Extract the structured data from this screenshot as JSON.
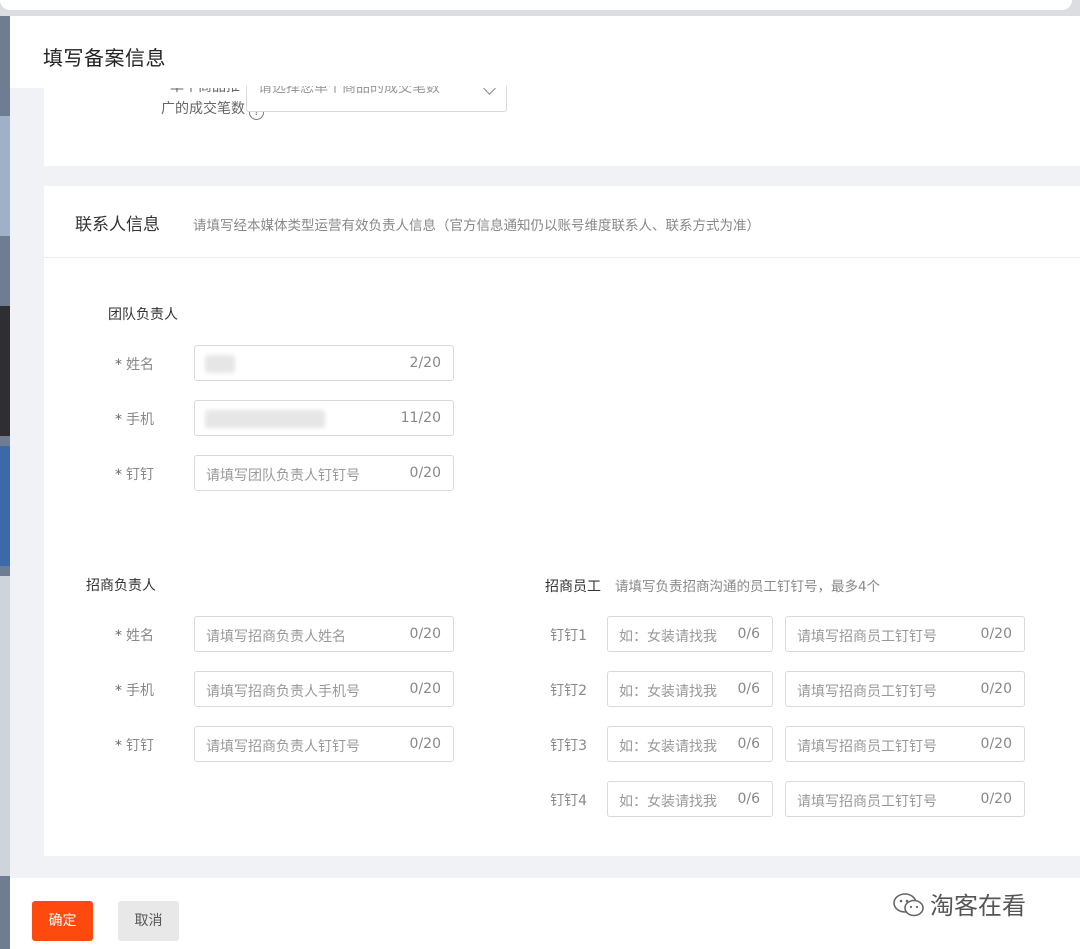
{
  "modal": {
    "title": "填写备案信息"
  },
  "top_field": {
    "label_line1_cut": "单个商品推",
    "label_line2": "广的成交笔数",
    "help": "?",
    "select_placeholder": "请选择您单个商品的成交笔数"
  },
  "contact": {
    "title": "联系人信息",
    "desc": "请填写经本媒体类型运营有效负责人信息（官方信息通知仍以账号维度联系人、联系方式为准）",
    "team_lead": {
      "title": "团队负责人",
      "rows": [
        {
          "label": "姓名",
          "placeholder": "",
          "count": "2/20"
        },
        {
          "label": "手机",
          "placeholder": "",
          "count": "11/20"
        },
        {
          "label": "钉钉",
          "placeholder": "请填写团队负责人钉钉号",
          "count": "0/20"
        }
      ]
    },
    "biz_lead": {
      "title": "招商负责人",
      "rows": [
        {
          "label": "姓名",
          "placeholder": "请填写招商负责人姓名",
          "count": "0/20"
        },
        {
          "label": "手机",
          "placeholder": "请填写招商负责人手机号",
          "count": "0/20"
        },
        {
          "label": "钉钉",
          "placeholder": "请填写招商负责人钉钉号",
          "count": "0/20"
        }
      ]
    },
    "biz_staff": {
      "title": "招商员工",
      "desc": "请填写负责招商沟通的员工钉钉号，最多4个",
      "rows": [
        {
          "label": "钉钉1",
          "note_placeholder": "如：女装请找我",
          "note_count": "0/6",
          "placeholder": "请填写招商员工钉钉号",
          "count": "0/20"
        },
        {
          "label": "钉钉2",
          "note_placeholder": "如：女装请找我",
          "note_count": "0/6",
          "placeholder": "请填写招商员工钉钉号",
          "count": "0/20"
        },
        {
          "label": "钉钉3",
          "note_placeholder": "如：女装请找我",
          "note_count": "0/6",
          "placeholder": "请填写招商员工钉钉号",
          "count": "0/20"
        },
        {
          "label": "钉钉4",
          "note_placeholder": "如：女装请找我",
          "note_count": "0/6",
          "placeholder": "请填写招商员工钉钉号",
          "count": "0/20"
        }
      ]
    },
    "required_mark": "*"
  },
  "footer": {
    "ok_label": "确定",
    "cancel_label": "取消",
    "watermark": "淘客在看"
  },
  "colors": {
    "primary": "#fe4a0e",
    "cancel_bg": "#e8e8e8"
  },
  "icons": {
    "help": "question-circle-icon",
    "select": "chevron-down-icon",
    "watermark": "wechat-icon"
  }
}
